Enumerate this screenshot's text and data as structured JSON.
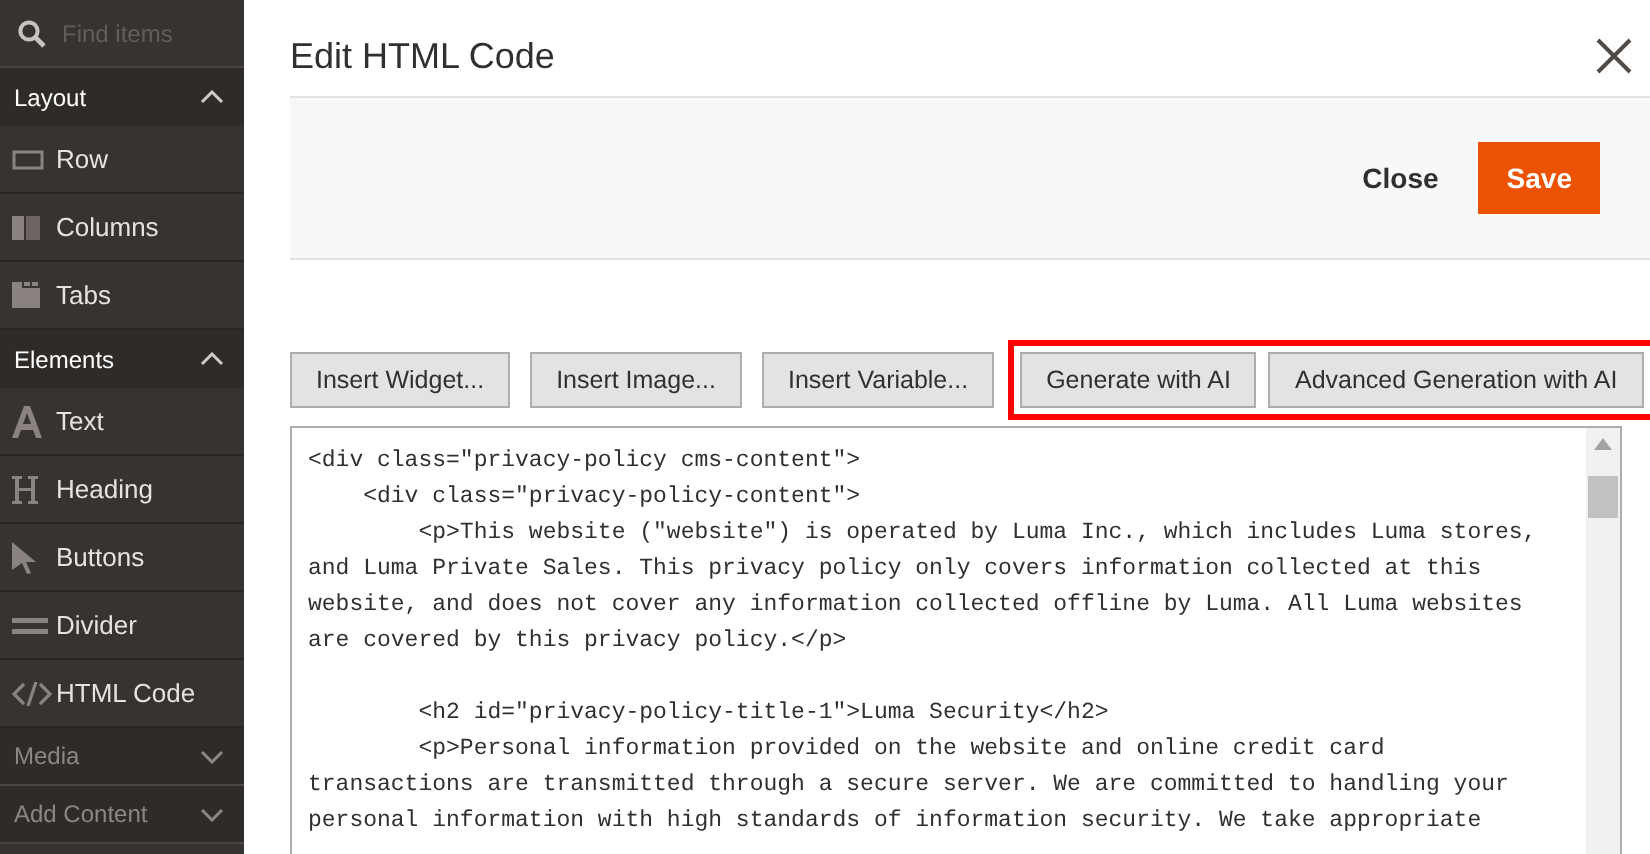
{
  "sidebar": {
    "search": {
      "placeholder": "Find items"
    },
    "sections": [
      {
        "title": "Layout",
        "expanded": true,
        "items": [
          {
            "label": "Row",
            "kind": "row"
          },
          {
            "label": "Columns",
            "kind": "columns"
          },
          {
            "label": "Tabs",
            "kind": "tabs"
          }
        ]
      },
      {
        "title": "Elements",
        "expanded": true,
        "items": [
          {
            "label": "Text",
            "kind": "text"
          },
          {
            "label": "Heading",
            "kind": "heading"
          },
          {
            "label": "Buttons",
            "kind": "buttons"
          },
          {
            "label": "Divider",
            "kind": "divider"
          },
          {
            "label": "HTML Code",
            "kind": "code"
          }
        ]
      },
      {
        "title": "Media",
        "expanded": false
      },
      {
        "title": "Add Content",
        "expanded": false
      }
    ]
  },
  "modal": {
    "title": "Edit HTML Code",
    "actions": [
      {
        "label": "Close",
        "kind": "link"
      },
      {
        "label": "Save",
        "kind": "primary"
      }
    ],
    "insert_buttons": [
      {
        "label": "Insert Widget..."
      },
      {
        "label": "Insert Image..."
      },
      {
        "label": "Insert Variable..."
      }
    ],
    "highlighted_buttons": [
      {
        "label": "Generate with AI"
      },
      {
        "label": "Advanced Generation with AI"
      }
    ],
    "code_blocks": [
      [
        "<div class=\"privacy-policy cms-content\">",
        "    <div class=\"privacy-policy-content\">",
        "        <p>This website (\"website\") is operated by Luma Inc., which includes Luma stores,",
        "and Luma Private Sales. This privacy policy only covers information collected at this",
        "website, and does not cover any information collected offline by Luma. All Luma websites",
        "are covered by this privacy policy.</p>"
      ],
      [
        "        <h2 id=\"privacy-policy-title-1\">Luma Security</h2>",
        "        <p>Personal information provided on the website and online credit card",
        "transactions are transmitted through a secure server. We are committed to handling your",
        "personal information with high standards of information security. We take appropriate"
      ]
    ]
  }
}
